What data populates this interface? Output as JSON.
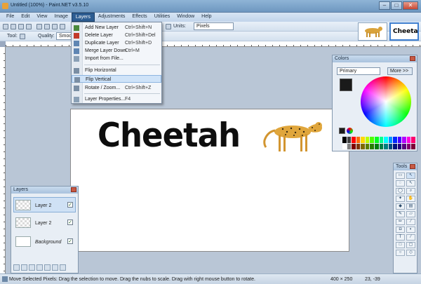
{
  "app": {
    "title": "Untitled (100%) - Paint.NET v3.5.10"
  },
  "window_buttons": {
    "minimize": "–",
    "maximize": "□",
    "close": "✕"
  },
  "menubar": [
    "File",
    "Edit",
    "View",
    "Image",
    "Layers",
    "Adjustments",
    "Effects",
    "Utilities",
    "Window",
    "Help"
  ],
  "toolbar": {
    "tool_label": "Tool:",
    "quality_label": "Quality:",
    "quality_value": "Smooth",
    "units_label": "Units:",
    "units_value": "Pixels"
  },
  "layers_menu": {
    "items": [
      {
        "label": "Add New Layer",
        "shortcut": "Ctrl+Shift+N",
        "icon": "add-layer-icon",
        "color": "#4a8a3c"
      },
      {
        "label": "Delete Layer",
        "shortcut": "Ctrl+Shift+Del",
        "icon": "delete-layer-icon",
        "color": "#c23a2a"
      },
      {
        "label": "Duplicate Layer",
        "shortcut": "Ctrl+Shift+D",
        "icon": "duplicate-layer-icon",
        "color": "#5f86b3"
      },
      {
        "label": "Merge Layer Down",
        "shortcut": "Ctrl+M",
        "icon": "merge-layer-icon",
        "color": "#5f86b3"
      },
      {
        "label": "Import from File...",
        "shortcut": "",
        "icon": "import-icon",
        "color": "#8aa0b6"
      },
      {
        "label": "Flip Horizontal",
        "shortcut": "",
        "icon": "flip-horizontal-icon",
        "color": "#7a8ea4"
      },
      {
        "label": "Flip Vertical",
        "shortcut": "",
        "icon": "flip-vertical-icon",
        "color": "#7a8ea4"
      },
      {
        "label": "Rotate / Zoom...",
        "shortcut": "Ctrl+Shift+Z",
        "icon": "rotate-zoom-icon",
        "color": "#7a8ea4"
      },
      {
        "label": "Layer Properties...",
        "shortcut": "F4",
        "icon": "layer-properties-icon",
        "color": "#8aa0b6"
      }
    ],
    "highlighted": "Flip Vertical"
  },
  "canvas": {
    "text": "Cheetah"
  },
  "layers_panel": {
    "title": "Layers",
    "rows": [
      {
        "name": "Layer 2",
        "checked": "✓"
      },
      {
        "name": "Layer 2",
        "checked": "✓"
      },
      {
        "name": "Background",
        "checked": "✓"
      }
    ]
  },
  "colors_panel": {
    "title": "Colors",
    "mode": "Primary",
    "more_button": "More >>",
    "primary_color": "#1a1a1a",
    "secondary_color": "#ffffff"
  },
  "tools_panel": {
    "title": "Tools"
  },
  "thumbnails": [
    {
      "label": ""
    },
    {
      "label": "Cheetah"
    }
  ],
  "status": {
    "text": "Move Selected Pixels: Drag the selection to move. Drag the nubs to scale. Drag with right mouse button to rotate.",
    "dimensions": "400 × 250",
    "coords": "23, -39"
  }
}
